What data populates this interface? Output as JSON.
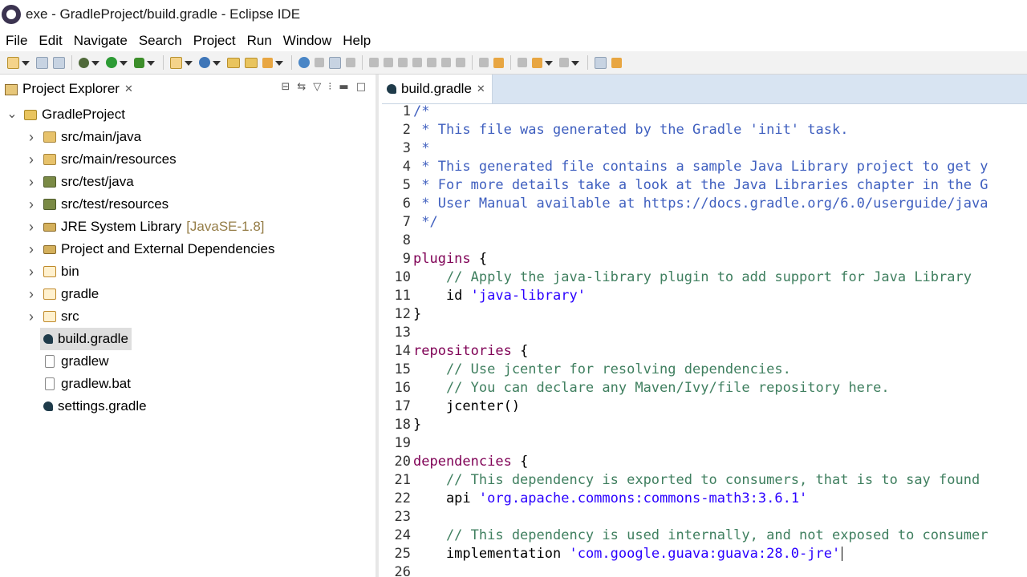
{
  "window": {
    "title": "exe - GradleProject/build.gradle - Eclipse IDE"
  },
  "menu": [
    "File",
    "Edit",
    "Navigate",
    "Search",
    "Project",
    "Run",
    "Window",
    "Help"
  ],
  "explorer": {
    "title": "Project Explorer",
    "tree": [
      {
        "label": "GradleProject",
        "icon": "project-folder-icon",
        "expanded": true,
        "level": 0
      },
      {
        "label": "src/main/java",
        "icon": "package-folder-icon",
        "expanded": false,
        "level": 1
      },
      {
        "label": "src/main/resources",
        "icon": "package-folder-icon",
        "expanded": false,
        "level": 1
      },
      {
        "label": "src/test/java",
        "icon": "test-package-folder-icon",
        "expanded": false,
        "level": 1
      },
      {
        "label": "src/test/resources",
        "icon": "test-package-folder-icon",
        "expanded": false,
        "level": 1
      },
      {
        "label": "JRE System Library",
        "tag": "[JavaSE-1.8]",
        "icon": "library-icon",
        "expanded": false,
        "level": 1
      },
      {
        "label": "Project and External Dependencies",
        "icon": "library-icon",
        "expanded": false,
        "level": 1
      },
      {
        "label": "bin",
        "icon": "folder-icon",
        "expanded": false,
        "level": 1
      },
      {
        "label": "gradle",
        "icon": "folder-icon",
        "expanded": false,
        "level": 1
      },
      {
        "label": "src",
        "icon": "folder-icon",
        "expanded": false,
        "level": 1
      },
      {
        "label": "build.gradle",
        "icon": "gradle-file-icon",
        "selected": true,
        "level": 1
      },
      {
        "label": "gradlew",
        "icon": "file-icon",
        "level": 1
      },
      {
        "label": "gradlew.bat",
        "icon": "file-icon",
        "level": 1
      },
      {
        "label": "settings.gradle",
        "icon": "gradle-file-icon",
        "level": 1
      }
    ]
  },
  "editor": {
    "tab": "build.gradle",
    "lines": [
      [
        {
          "t": "/*",
          "c": "cmt"
        }
      ],
      [
        {
          "t": " * This file was generated by the Gradle 'init' task.",
          "c": "cmt"
        }
      ],
      [
        {
          "t": " *",
          "c": "cmt"
        }
      ],
      [
        {
          "t": " * This generated file contains a sample Java Library project to get y",
          "c": "cmt"
        }
      ],
      [
        {
          "t": " * For more details take a look at the Java Libraries chapter in the G",
          "c": "cmt"
        }
      ],
      [
        {
          "t": " * User Manual available at https://docs.gradle.org/6.0/userguide/java",
          "c": "cmt"
        }
      ],
      [
        {
          "t": " */",
          "c": "cmt"
        }
      ],
      [],
      [
        {
          "t": "plugins",
          "c": "kw"
        },
        {
          "t": " {",
          "c": ""
        }
      ],
      [
        {
          "t": "    // Apply the java-library plugin to add support for Java Library",
          "c": "cmt-line"
        }
      ],
      [
        {
          "t": "    id ",
          "c": ""
        },
        {
          "t": "'java-library'",
          "c": "str"
        }
      ],
      [
        {
          "t": "}",
          "c": ""
        }
      ],
      [],
      [
        {
          "t": "repositories",
          "c": "kw"
        },
        {
          "t": " {",
          "c": ""
        }
      ],
      [
        {
          "t": "    // Use jcenter for resolving dependencies.",
          "c": "cmt-line"
        }
      ],
      [
        {
          "t": "    // You can declare any Maven/Ivy/file repository here.",
          "c": "cmt-line"
        }
      ],
      [
        {
          "t": "    jcenter()",
          "c": ""
        }
      ],
      [
        {
          "t": "}",
          "c": ""
        }
      ],
      [],
      [
        {
          "t": "dependencies",
          "c": "kw"
        },
        {
          "t": " {",
          "c": ""
        }
      ],
      [
        {
          "t": "    // This dependency is exported to consumers, that is to say found",
          "c": "cmt-line"
        }
      ],
      [
        {
          "t": "    api ",
          "c": ""
        },
        {
          "t": "'org.apache.commons:commons-math3:3.6.1'",
          "c": "str"
        }
      ],
      [],
      [
        {
          "t": "    // This dependency is used internally, and not exposed to consumer",
          "c": "cmt-line"
        }
      ],
      [
        {
          "t": "    implementation ",
          "c": ""
        },
        {
          "t": "'com.google.guava:guava:28.0-jre'",
          "c": "str"
        }
      ],
      []
    ],
    "caret_line": 25
  }
}
